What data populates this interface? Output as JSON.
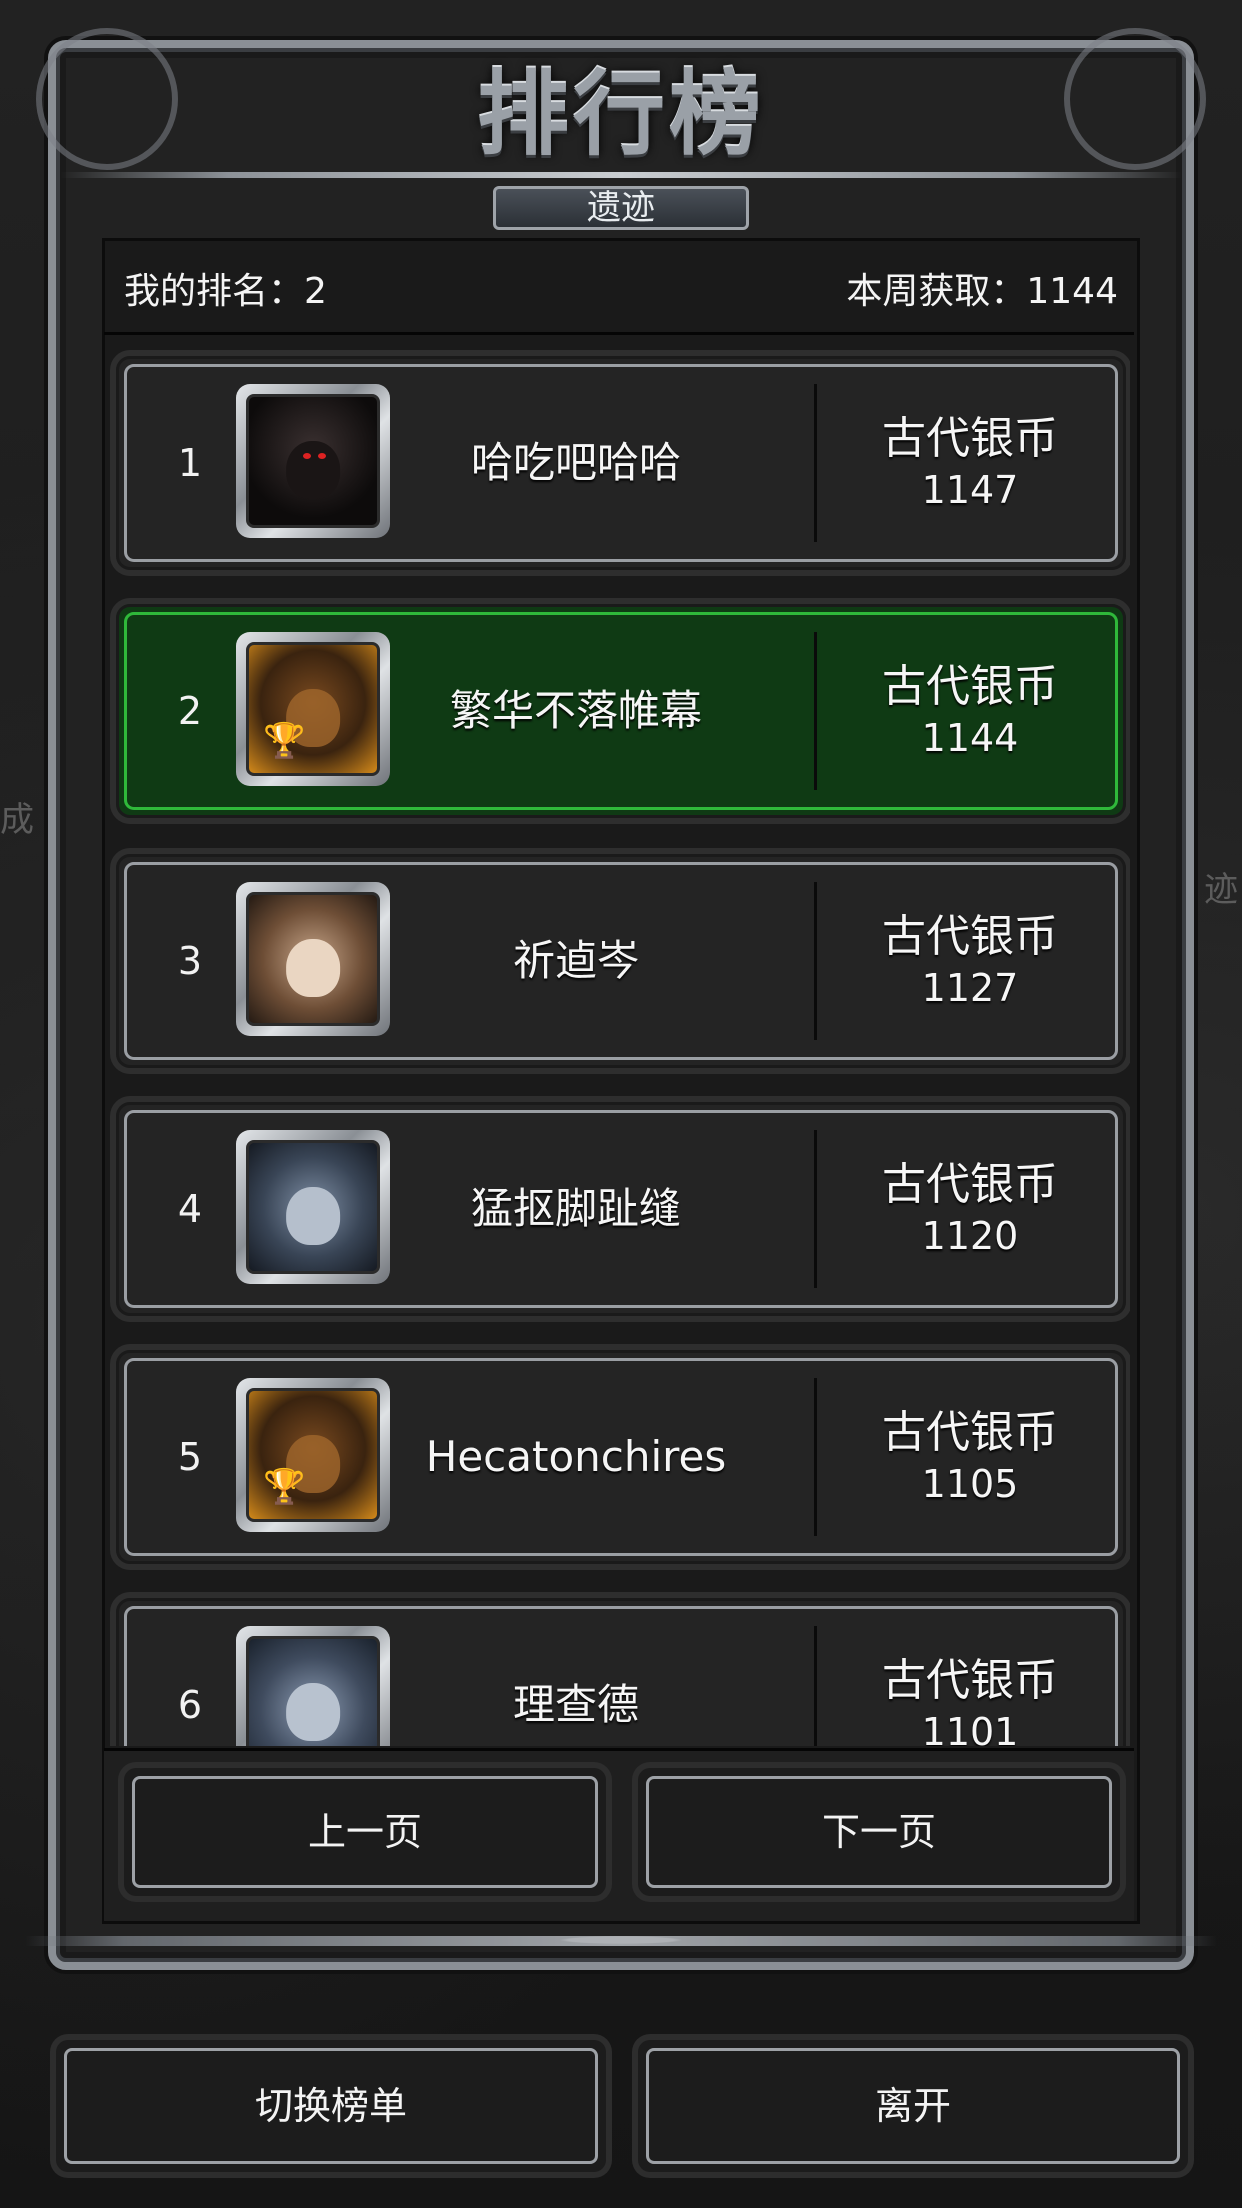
{
  "title": "排行榜",
  "subtitle_tab": "遗迹",
  "my_rank": "我的排名：2",
  "week_gain": "本周获取：1144",
  "entries": [
    {
      "rank": "1",
      "name": "哈吃吧哈哈",
      "currency": "古代银币",
      "score": "1147",
      "avatar": "dark-hooded-figure-avatar",
      "highlight": false
    },
    {
      "rank": "2",
      "name": "繁华不落帷幕",
      "currency": "古代银币",
      "score": "1144",
      "avatar": "hooded-rogue-trophy-avatar",
      "highlight": true
    },
    {
      "rank": "3",
      "name": "祈逌岑",
      "currency": "古代银币",
      "score": "1127",
      "avatar": "nun-portrait-avatar",
      "highlight": false
    },
    {
      "rank": "4",
      "name": "猛抠脚趾缝",
      "currency": "古代银币",
      "score": "1120",
      "avatar": "demon-woman-avatar",
      "highlight": false
    },
    {
      "rank": "5",
      "name": "Hecatonchires",
      "currency": "古代银币",
      "score": "1105",
      "avatar": "hooded-rogue-trophy-avatar",
      "highlight": false
    },
    {
      "rank": "6",
      "name": "理查德",
      "currency": "古代银币",
      "score": "1101",
      "avatar": "hooded-woman-avatar",
      "highlight": false
    }
  ],
  "buttons": {
    "prev_page": "上一页",
    "next_page": "下一页",
    "switch_board": "切换榜单",
    "leave": "离开"
  },
  "background": {
    "left_text": "成",
    "right_text": "迹"
  },
  "colors": {
    "highlight_row": "#0f3a14",
    "highlight_border": "#2fb83a",
    "frame_metal": "#9a9ea3"
  }
}
